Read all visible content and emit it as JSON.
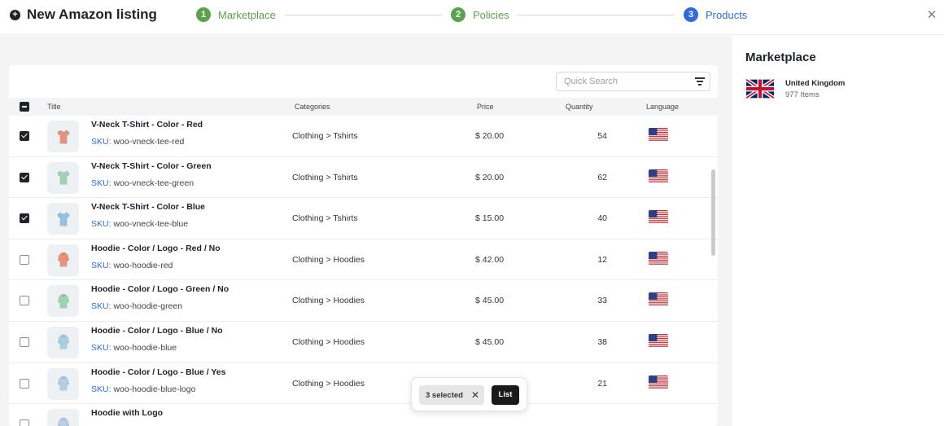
{
  "header": {
    "title": "New Amazon listing",
    "steps": [
      {
        "num": "1",
        "label": "Marketplace",
        "state": "done"
      },
      {
        "num": "2",
        "label": "Policies",
        "state": "done"
      },
      {
        "num": "3",
        "label": "Products",
        "state": "active"
      }
    ],
    "close_icon": "close-icon"
  },
  "colors": {
    "done": "#5ba24c",
    "active": "#2f6be0",
    "sku_label": "#2f6be0"
  },
  "search": {
    "placeholder": "Quick Search",
    "value": ""
  },
  "table": {
    "columns": [
      "Title",
      "Categories",
      "Price",
      "Quantity",
      "Language"
    ],
    "rows": [
      {
        "checked": true,
        "name": "V-Neck T-Shirt - Color - Red",
        "sku_label": "SKU:",
        "sku": "woo-vneck-tee-red",
        "category": "Clothing > Tshirts",
        "price": "$ 20.00",
        "quantity": "54",
        "product": "tshirt",
        "color": "#e8917c",
        "language_icon": "us-flag-icon"
      },
      {
        "checked": true,
        "name": "V-Neck T-Shirt - Color - Green",
        "sku_label": "SKU:",
        "sku": "woo-vneck-tee-green",
        "category": "Clothing > Tshirts",
        "price": "$ 20.00",
        "quantity": "62",
        "product": "tshirt",
        "color": "#9fd3b3",
        "language_icon": "us-flag-icon"
      },
      {
        "checked": true,
        "name": "V-Neck T-Shirt - Color - Blue",
        "sku_label": "SKU:",
        "sku": "woo-vneck-tee-blue",
        "category": "Clothing > Tshirts",
        "price": "$ 15.00",
        "quantity": "40",
        "product": "tshirt",
        "color": "#8ec4dd",
        "language_icon": "us-flag-icon"
      },
      {
        "checked": false,
        "name": "Hoodie - Color / Logo - Red / No",
        "sku_label": "SKU:",
        "sku": "woo-hoodie-red",
        "category": "Clothing > Hoodies",
        "price": "$ 42.00",
        "quantity": "12",
        "product": "hoodie",
        "color": "#e8917c",
        "language_icon": "us-flag-icon"
      },
      {
        "checked": false,
        "name": "Hoodie - Color / Logo - Green / No",
        "sku_label": "SKU:",
        "sku": "woo-hoodie-green",
        "category": "Clothing > Hoodies",
        "price": "$ 45.00",
        "quantity": "33",
        "product": "hoodie",
        "color": "#9fd3b3",
        "language_icon": "us-flag-icon"
      },
      {
        "checked": false,
        "name": "Hoodie - Color / Logo - Blue / No",
        "sku_label": "SKU:",
        "sku": "woo-hoodie-blue",
        "category": "Clothing > Hoodies",
        "price": "$ 45.00",
        "quantity": "38",
        "product": "hoodie",
        "color": "#a9cde3",
        "language_icon": "us-flag-icon"
      },
      {
        "checked": false,
        "name": "Hoodie - Color / Logo - Blue / Yes",
        "sku_label": "SKU:",
        "sku": "woo-hoodie-blue-logo",
        "category": "Clothing > Hoodies",
        "price": "",
        "quantity": "21",
        "product": "hoodie",
        "color": "#b4cfe6",
        "language_icon": "us-flag-icon"
      },
      {
        "checked": false,
        "name": "Hoodie with Logo",
        "sku_label": "",
        "sku": "",
        "category": "",
        "price": "",
        "quantity": "",
        "product": "hoodie",
        "color": "#b4cfe6",
        "language_icon": ""
      }
    ]
  },
  "selection": {
    "count_label": "3 selected",
    "list_label": "List"
  },
  "sidebar": {
    "title": "Marketplace",
    "marketplace": {
      "name": "United Kingdom",
      "items": "977 Items",
      "flag_icon": "uk-flag-icon"
    }
  }
}
